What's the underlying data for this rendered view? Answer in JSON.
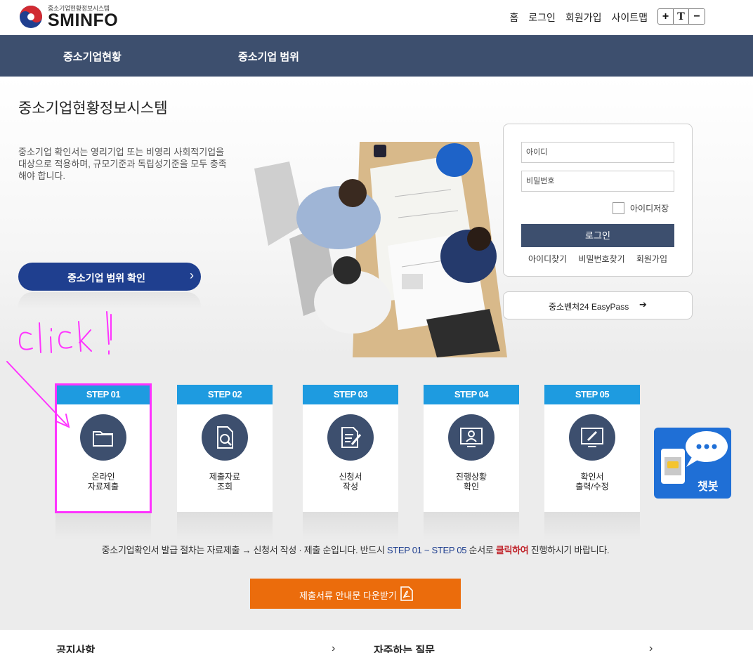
{
  "header": {
    "logo_small": "중소기업현황정보시스템",
    "logo_big": "SMINFO",
    "nav": [
      "홈",
      "로그인",
      "회원가입",
      "사이트맵"
    ],
    "font_controls": [
      "+",
      "T",
      "−"
    ]
  },
  "gnb": {
    "items": [
      "중소기업현황",
      "중소기업 범위"
    ]
  },
  "hero": {
    "title": "중소기업현황정보시스템",
    "description": "중소기업 확인서는 영리기업 또는 비영리 사회적기업을 대상으로 적용하며, 규모기준과 독립성기준을 모두 충족해야 합니다.",
    "range_button": "중소기업 범위 확인",
    "range_chevron": "›"
  },
  "login": {
    "id_placeholder": "아이디",
    "pw_placeholder": "비밀번호",
    "save_id": "아이디저장",
    "login_button": "로그인",
    "links": [
      "아이디찾기",
      "비밀번호찾기",
      "회원가입"
    ],
    "easypass": "중소벤처24 EasyPass",
    "easypass_arrow": "➔"
  },
  "steps": [
    {
      "label": "STEP 01",
      "text": "온라인\n자료제출",
      "icon": "folder-icon"
    },
    {
      "label": "STEP 02",
      "text": "제출자료\n조회",
      "icon": "document-search-icon"
    },
    {
      "label": "STEP 03",
      "text": "신청서\n작성",
      "icon": "document-edit-icon"
    },
    {
      "label": "STEP 04",
      "text": "진행상황\n확인",
      "icon": "monitor-user-icon"
    },
    {
      "label": "STEP 05",
      "text": "확인서\n출력/수정",
      "icon": "monitor-edit-icon"
    }
  ],
  "chatbot": {
    "label": "챗봇"
  },
  "notice": {
    "part1": "중소기업확인서 발급 절차는 자료제출 → 신청서 작성 · 제출 순입니다. 반드시 ",
    "part2": "STEP 01 ~ STEP 05",
    "part3": " 순서로 ",
    "part4": "클릭하여",
    "part5": " 진행하시기 바랍니다."
  },
  "download_button": "제출서류 안내문 다운받기",
  "bottom": {
    "notice_title": "공지사항",
    "faq_title": "자주하는 질문",
    "chevron": "›"
  },
  "annotation": {
    "text": "click!",
    "color": "#ff33ff"
  },
  "colors": {
    "navy": "#3d4f6e",
    "step_blue": "#1e9be0",
    "orange": "#eb6c0c",
    "range_blue": "#1f3f8f"
  }
}
